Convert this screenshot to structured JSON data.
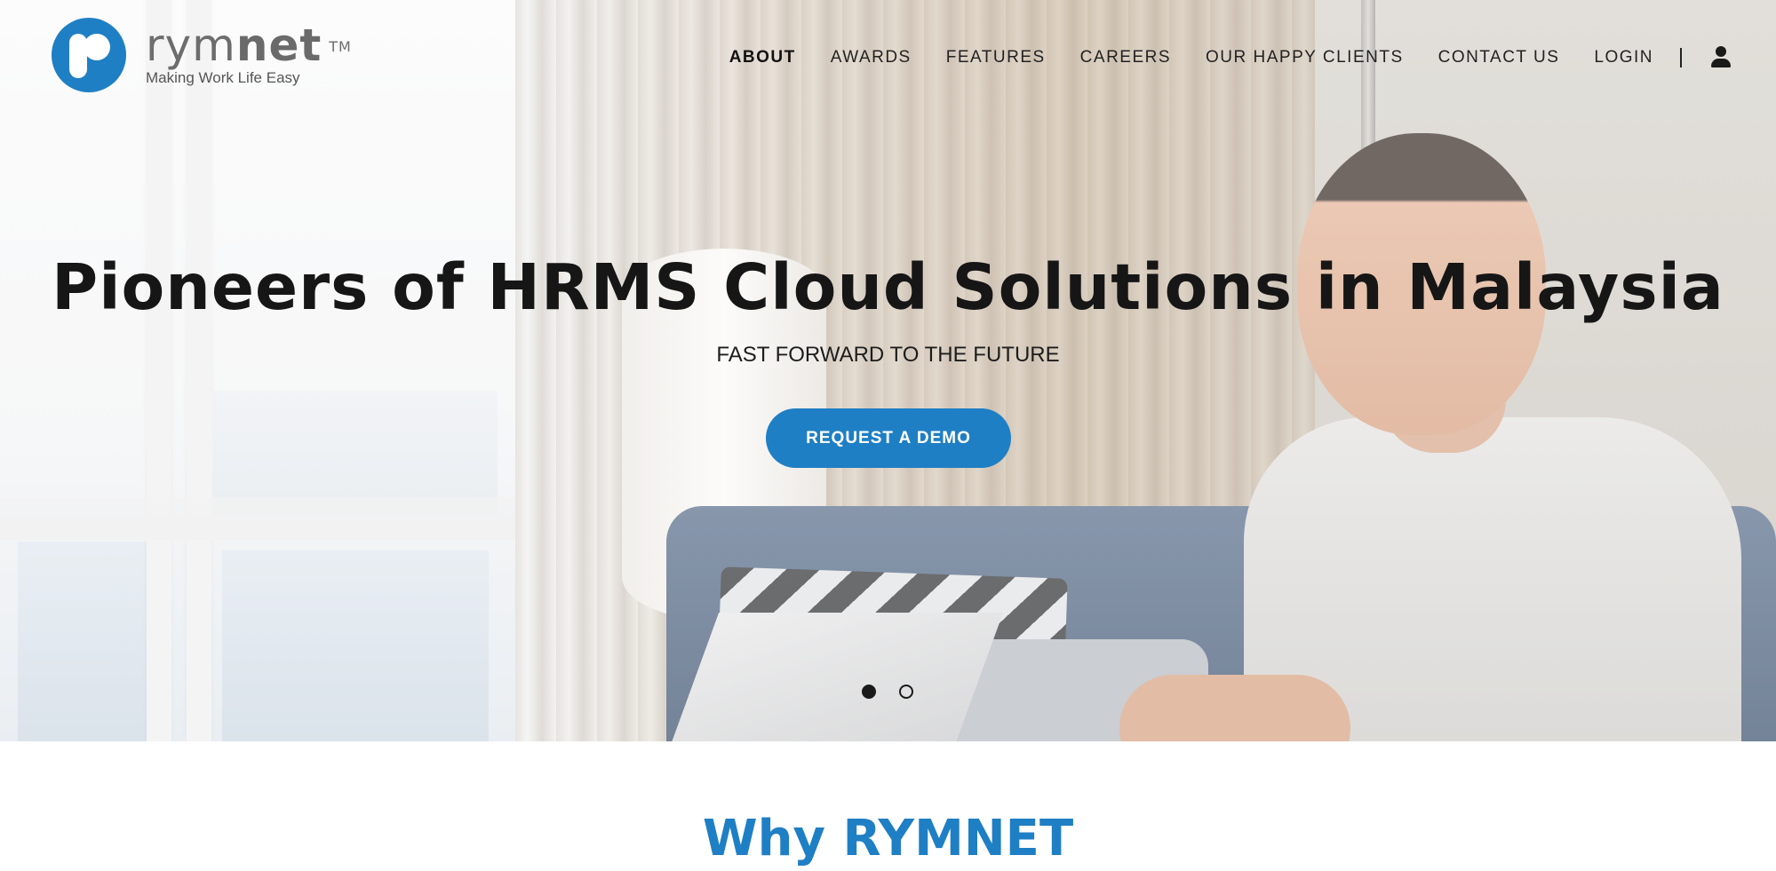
{
  "brand": {
    "name_light": "rym",
    "name_bold": "net",
    "trademark": "TM",
    "tagline": "Making Work Life Easy",
    "accent_color": "#1f7fc4"
  },
  "nav": {
    "items": [
      {
        "label": "ABOUT",
        "active": true
      },
      {
        "label": "AWARDS",
        "active": false
      },
      {
        "label": "FEATURES",
        "active": false
      },
      {
        "label": "CAREERS",
        "active": false
      },
      {
        "label": "OUR HAPPY CLIENTS",
        "active": false
      },
      {
        "label": "CONTACT US",
        "active": false
      },
      {
        "label": "LOGIN",
        "active": false
      }
    ],
    "account_icon": "user-icon"
  },
  "hero": {
    "title": "Pioneers of HRMS Cloud Solutions in Malaysia",
    "subtitle": "FAST FORWARD TO THE FUTURE",
    "cta_label": "REQUEST A DEMO",
    "slides_total": 2,
    "active_slide": 1
  },
  "why_section": {
    "heading": "Why RYMNET"
  }
}
